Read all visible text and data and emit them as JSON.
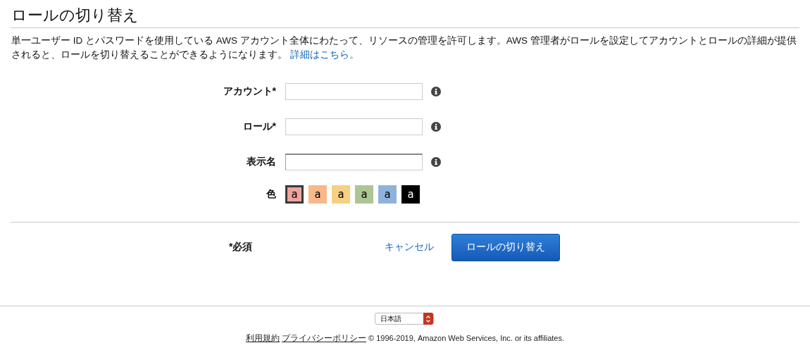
{
  "page": {
    "title": "ロールの切り替え",
    "description": "単一ユーザー ID とパスワードを使用している AWS アカウント全体にわたって、リソースの管理を許可します。AWS 管理者がロールを設定してアカウントとロールの詳細が提供されると、ロールを切り替えることができるようになります。",
    "more_link": "詳細はこちら。"
  },
  "form": {
    "fields": [
      {
        "label": "アカウント*"
      },
      {
        "label": "ロール*"
      },
      {
        "label": "表示名"
      }
    ],
    "color_label": "色",
    "swatches": [
      {
        "label": "a",
        "color": "#eea49e",
        "selected": true
      },
      {
        "label": "a",
        "color": "#f8b888",
        "selected": false
      },
      {
        "label": "a",
        "color": "#f7d083",
        "selected": false
      },
      {
        "label": "a",
        "color": "#acc594",
        "selected": false
      },
      {
        "label": "a",
        "color": "#8fb2dd",
        "selected": false
      },
      {
        "label": "a",
        "color": "#000000",
        "selected": false
      }
    ]
  },
  "actions": {
    "required_note": "*必須",
    "cancel": "キャンセル",
    "submit": "ロールの切り替え"
  },
  "footer": {
    "language": "日本語",
    "terms": "利用規約",
    "privacy": "プライバシーポリシー",
    "copyright": "© 1996-2019, Amazon Web Services, Inc. or its affiliates."
  }
}
